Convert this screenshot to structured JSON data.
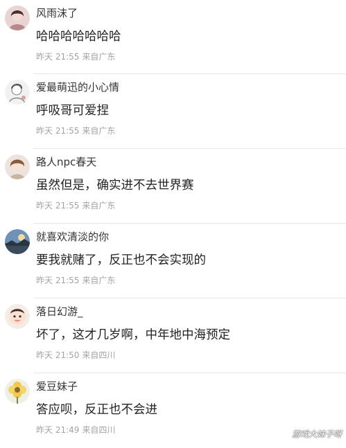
{
  "comments": [
    {
      "username": "风雨沫了",
      "content": "哈哈哈哈哈哈哈",
      "time": "昨天 21:55",
      "location": "来自广东",
      "avatar_icon": "avatar-girl-portrait"
    },
    {
      "username": "爱最萌迅的小心情",
      "content": "呼吸哥可爱捏",
      "time": "昨天 21:55",
      "location": "来自广东",
      "avatar_icon": "avatar-sketch"
    },
    {
      "username": "路人npc春天",
      "content": "虽然但是，确实进不去世界赛",
      "time": "昨天 21:55",
      "location": "来自广东",
      "avatar_icon": "avatar-anime"
    },
    {
      "username": "就喜欢清淡的你",
      "content": "要我就赌了，反正也不会实现的",
      "time": "昨天 21:55",
      "location": "来自广东",
      "avatar_icon": "avatar-sky"
    },
    {
      "username": "落日幻游_",
      "content": "坏了，这才几岁啊，中年地中海预定",
      "time": "昨天 21:50",
      "location": "来自四川",
      "avatar_icon": "avatar-baby"
    },
    {
      "username": "爱豆妹子",
      "content": "答应呗，反正也不会进",
      "time": "昨天 21:49",
      "location": "来自四川",
      "avatar_icon": "avatar-flower"
    }
  ],
  "watermark": "游戏大妹子呀"
}
